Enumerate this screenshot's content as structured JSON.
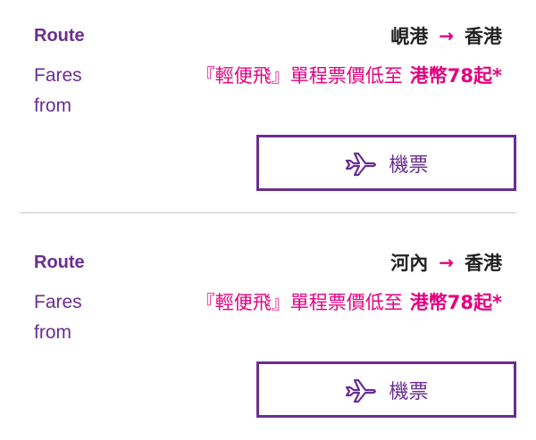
{
  "cards": [
    {
      "route_label": "Route",
      "origin": "峴港",
      "arrow": "→",
      "destination": "香港",
      "fares_label": "Fares from",
      "fares_desc": "『輕便飛』單程票價低至",
      "fares_price": "港幣78起*",
      "button_label": "機票",
      "button_icon": "plane-icon"
    },
    {
      "route_label": "Route",
      "origin": "河內",
      "arrow": "→",
      "destination": "香港",
      "fares_label": "Fares from",
      "fares_desc": "『輕便飛』單程票價低至",
      "fares_price": "港幣78起*",
      "button_label": "機票",
      "button_icon": "plane-icon"
    }
  ],
  "colors": {
    "brand_purple": "#6a2d91",
    "accent_pink": "#e4007f",
    "text_dark": "#222222",
    "divider": "#c9c3d6"
  }
}
